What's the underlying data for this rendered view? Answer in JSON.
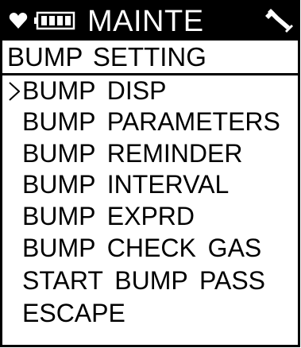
{
  "status_bar": {
    "mode_title": "MAINTE",
    "icons": [
      "heart-icon",
      "battery-icon",
      "wrench-icon"
    ],
    "background": "#000000",
    "foreground": "#ffffff"
  },
  "menu": {
    "title": "BUMP SETTING",
    "selected_index": 0,
    "items": [
      {
        "label": "BUMP DISP"
      },
      {
        "label": "BUMP PARAMETERS"
      },
      {
        "label": "BUMP REMINDER"
      },
      {
        "label": "BUMP INTERVAL"
      },
      {
        "label": "BUMP EXPRD"
      },
      {
        "label": "BUMP CHECK GAS"
      },
      {
        "label": "START BUMP PASS"
      },
      {
        "label": "ESCAPE"
      }
    ]
  }
}
